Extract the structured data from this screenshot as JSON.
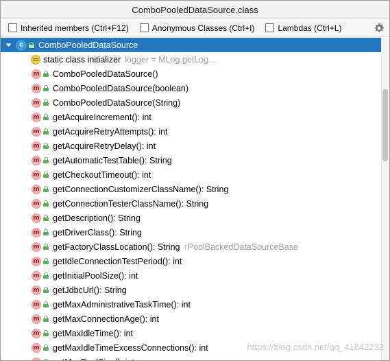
{
  "window": {
    "title": "ComboPooledDataSource.class"
  },
  "options": [
    {
      "label": "Inherited members (Ctrl+F12)"
    },
    {
      "label": "Anonymous Classes (Ctrl+I)"
    },
    {
      "label": "Lambdas (Ctrl+L)"
    }
  ],
  "settings_icon": "gear-icon",
  "root": {
    "name": "ComboPooledDataSource",
    "icon_letter": "c"
  },
  "static_init": {
    "label": "static class initializer",
    "value": "logger = MLog.getLog..."
  },
  "members": [
    {
      "label": "ComboPooledDataSource()"
    },
    {
      "label": "ComboPooledDataSource(boolean)"
    },
    {
      "label": "ComboPooledDataSource(String)"
    },
    {
      "label": "getAcquireIncrement(): int"
    },
    {
      "label": "getAcquireRetryAttempts(): int"
    },
    {
      "label": "getAcquireRetryDelay(): int"
    },
    {
      "label": "getAutomaticTestTable(): String"
    },
    {
      "label": "getCheckoutTimeout(): int"
    },
    {
      "label": "getConnectionCustomizerClassName(): String"
    },
    {
      "label": "getConnectionTesterClassName(): String"
    },
    {
      "label": "getDescription(): String"
    },
    {
      "label": "getDriverClass(): String"
    },
    {
      "label": "getFactoryClassLocation(): String",
      "inherited": "↑PoolBackedDataSourceBase"
    },
    {
      "label": "getIdleConnectionTestPeriod(): int"
    },
    {
      "label": "getInitialPoolSize(): int"
    },
    {
      "label": "getJdbcUrl(): String"
    },
    {
      "label": "getMaxAdministrativeTaskTime(): int"
    },
    {
      "label": "getMaxConnectionAge(): int"
    },
    {
      "label": "getMaxIdleTime(): int"
    },
    {
      "label": "getMaxIdleTimeExcessConnections(): int"
    },
    {
      "label": "getMaxPoolSize(): int"
    }
  ],
  "member_icon_letter": "m",
  "watermark": "https://blog.csdn.net/qq_41842232"
}
